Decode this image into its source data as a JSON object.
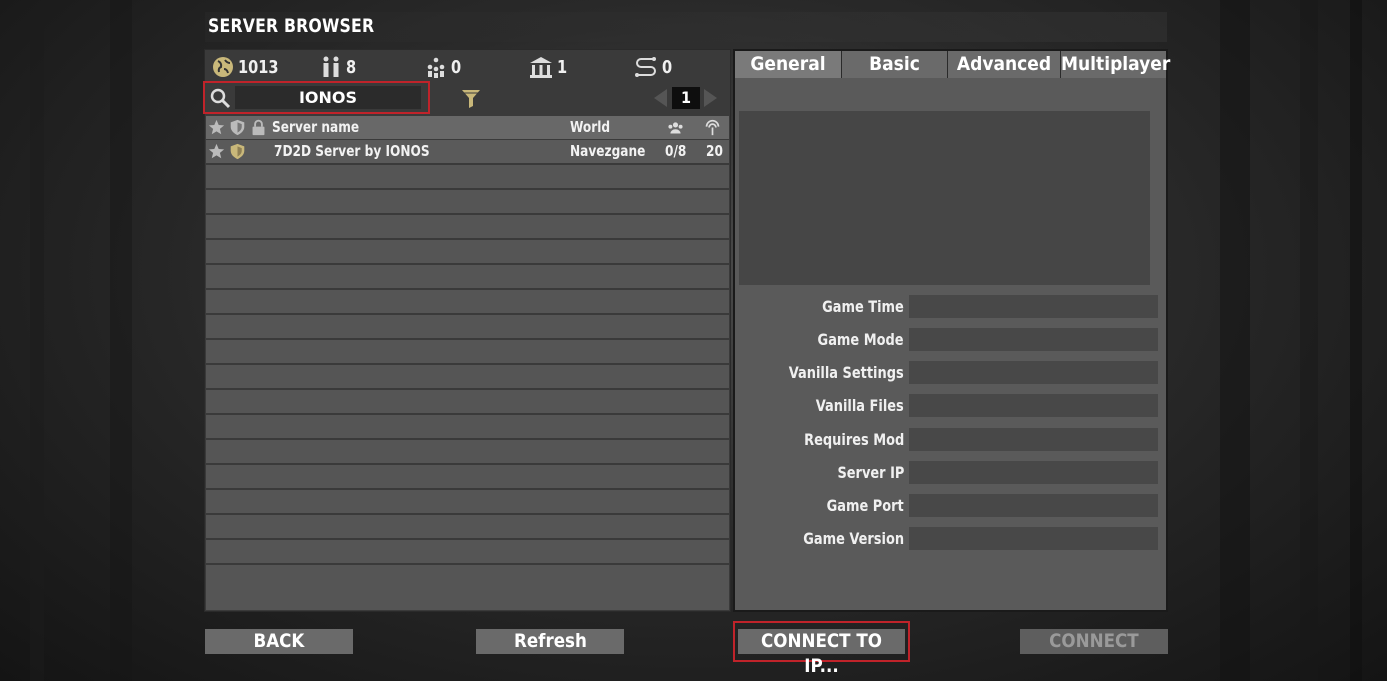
{
  "window": {
    "title": "SERVER BROWSER"
  },
  "stats": [
    {
      "icon": "globe-icon",
      "value": "1013"
    },
    {
      "icon": "players-icon",
      "value": "8"
    },
    {
      "icon": "group-icon",
      "value": "0"
    },
    {
      "icon": "building-icon",
      "value": "1"
    },
    {
      "icon": "route-icon",
      "value": "0"
    }
  ],
  "search": {
    "value": "IONOS"
  },
  "pager": {
    "page": "1"
  },
  "list": {
    "headers": {
      "name": "Server name",
      "world": "World"
    },
    "rows": [
      {
        "name": "7D2D Server by IONOS",
        "world": "Navezgane",
        "players": "0/8",
        "ping": "20"
      }
    ]
  },
  "tabs": [
    "General",
    "Basic",
    "Advanced",
    "Multiplayer"
  ],
  "info_fields": [
    {
      "label": "Game Time",
      "value": ""
    },
    {
      "label": "Game Mode",
      "value": ""
    },
    {
      "label": "Vanilla Settings",
      "value": ""
    },
    {
      "label": "Vanilla Files",
      "value": ""
    },
    {
      "label": "Requires Mod",
      "value": ""
    },
    {
      "label": "Server IP",
      "value": ""
    },
    {
      "label": "Game Port",
      "value": ""
    },
    {
      "label": "Game Version",
      "value": ""
    }
  ],
  "buttons": {
    "back": "BACK",
    "refresh": "Refresh",
    "connect_ip": "CONNECT TO IP...",
    "connect": "CONNECT"
  },
  "colors": {
    "highlight": "#c0232a",
    "accent_yellow": "#c9b87a"
  }
}
